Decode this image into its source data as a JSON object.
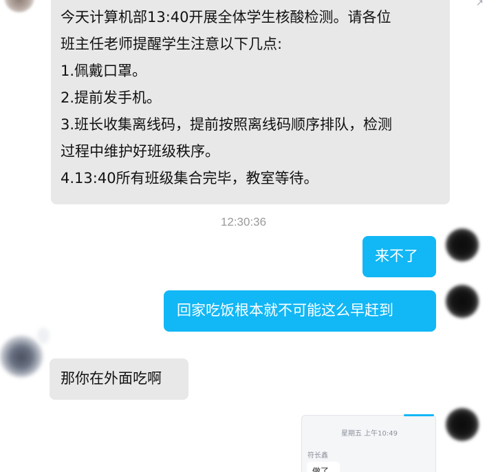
{
  "chat": {
    "notice_message": {
      "lines": [
        "今天计算机部13:40开展全体学生核酸检测。请各位",
        "班主任老师提醒学生注意以下几点:",
        "1.佩戴口罩。",
        "2.提前发手机。",
        "3.班长收集离线码，提前按照离线码顺序排队，检测",
        "过程中维护好班级秩序。",
        "4.13:40所有班级集合完毕，教室等待。"
      ]
    },
    "timestamp": "12:30:36",
    "messages": [
      {
        "side": "right",
        "text": "来不了"
      },
      {
        "side": "right",
        "text": "回家吃饭根本就不可能这么早赶到"
      },
      {
        "side": "left",
        "text": "那你在外面吃啊"
      }
    ],
    "forwarded_card": {
      "time": "星期五 上午10:49",
      "sender": "符长鑫",
      "message": "做了"
    },
    "colors": {
      "bubble_blue": "#12b7f5",
      "bubble_gray": "#e8e8e9",
      "timestamp_gray": "#9a9a9a"
    }
  }
}
